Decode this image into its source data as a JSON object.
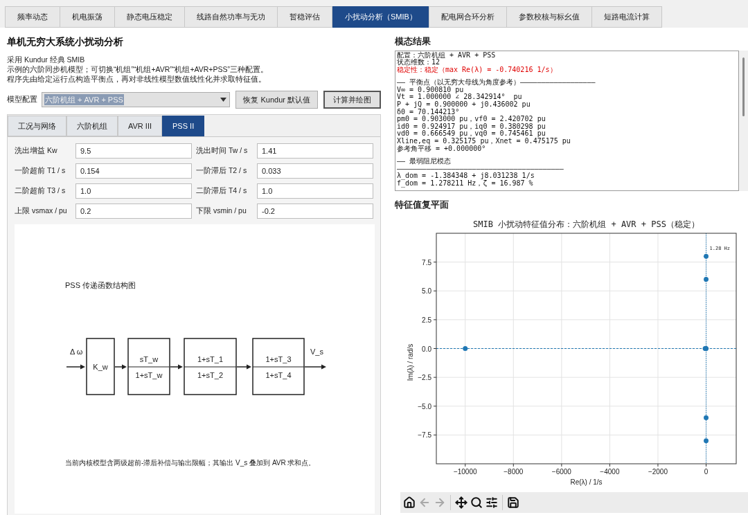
{
  "main_tabs": [
    {
      "label": "频率动态",
      "selected": false
    },
    {
      "label": "机电振荡",
      "selected": false
    },
    {
      "label": "静态电压稳定",
      "selected": false
    },
    {
      "label": "线路自然功率与无功",
      "selected": false
    },
    {
      "label": "暂稳评估",
      "selected": false
    },
    {
      "label": "小扰动分析（SMIB）",
      "selected": true
    },
    {
      "label": "配电网合环分析",
      "selected": false
    },
    {
      "label": "参数校核与标幺值",
      "selected": false
    },
    {
      "label": "短路电流计算",
      "selected": false
    }
  ],
  "left": {
    "title": "单机无穷大系统小扰动分析",
    "description": [
      "采用 Kundur 经典 SMIB",
      "示例的六阶同步机模型；可切换“机组”“机组+AVR”“机组+AVR+PSS”三种配置。",
      "程序先由给定运行点构造平衡点，再对非线性模型数值线性化并求取特征值。"
    ],
    "model_label": "模型配置",
    "model_value": "六阶机组 + AVR + PSS",
    "buttons": [
      {
        "label": "恢复 Kundur 默认值",
        "focused": false
      },
      {
        "label": "计算并绘图",
        "focused": true
      }
    ],
    "sub_tabs": [
      {
        "label": "工况与网络",
        "selected": false
      },
      {
        "label": "六阶机组",
        "selected": false
      },
      {
        "label": "AVR III",
        "selected": false
      },
      {
        "label": "PSS II",
        "selected": true
      }
    ],
    "fields": [
      {
        "label": "洗出增益 Kw",
        "value": "9.5"
      },
      {
        "label": "洗出时间 Tw / s",
        "value": "1.41"
      },
      {
        "label": "一阶超前 T1 / s",
        "value": "0.154"
      },
      {
        "label": "一阶滞后 T2 / s",
        "value": "0.033"
      },
      {
        "label": "二阶超前 T3 / s",
        "value": "1.0"
      },
      {
        "label": "二阶滞后 T4 / s",
        "value": "1.0"
      },
      {
        "label": "上限 vsmax / pu",
        "value": "0.2"
      },
      {
        "label": "下限 vsmin / pu",
        "value": "-0.2"
      }
    ],
    "diagram": {
      "title": "PSS 传递函数结构图",
      "input_label": "Δ ω",
      "output_label": "V_s",
      "blocks": [
        {
          "kind": "gain",
          "label": "K_w"
        },
        {
          "kind": "fraction",
          "numerator": "sT_w",
          "denominator": "1+sT_w"
        },
        {
          "kind": "fraction",
          "numerator": "1+sT_1",
          "denominator": "1+sT_2"
        },
        {
          "kind": "fraction",
          "numerator": "1+sT_3",
          "denominator": "1+sT_4"
        }
      ],
      "caption": "当前内核模型含两级超前-滞后补偿与输出限幅；其输出 V_s 叠加到 AVR 求和点。"
    }
  },
  "right": {
    "results_title": "模态结果",
    "results_lines": [
      {
        "kind": "normal",
        "text": "配置：六阶机组 + AVR + PSS"
      },
      {
        "kind": "normal",
        "text": "状态维数：12"
      },
      {
        "kind": "alert",
        "text": "稳定性：稳定（max Re(λ) = -0.740216 1/s）"
      },
      {
        "kind": "section",
        "text": "—— 平衡点（以无穷大母线为角度参考）——————————————————"
      },
      {
        "kind": "normal",
        "text": "V∞ = 0.900810 pu"
      },
      {
        "kind": "normal",
        "text": "Vt = 1.000000 ∠ 28.342914°  pu"
      },
      {
        "kind": "normal",
        "text": "P + jQ = 0.900000 + j0.436002 pu"
      },
      {
        "kind": "normal",
        "text": "δ0 = 70.144213°"
      },
      {
        "kind": "normal",
        "text": "pm0 = 0.903000 pu，vf0 = 2.420702 pu"
      },
      {
        "kind": "normal",
        "text": "id0 = 0.924917 pu，iq0 = 0.380298 pu"
      },
      {
        "kind": "normal",
        "text": "vd0 = 0.666549 pu，vq0 = 0.745461 pu"
      },
      {
        "kind": "normal",
        "text": "Xline,eq = 0.325175 pu，Xnet = 0.475175 pu"
      },
      {
        "kind": "normal",
        "text": "参考角平移 = +0.000000°"
      },
      {
        "kind": "section",
        "text": "—— 最弱阻尼模态"
      },
      {
        "kind": "normal",
        "text": "————————————————————————————————————————"
      },
      {
        "kind": "normal",
        "text": "λ_dom = -1.384348 + j8.031238 1/s"
      },
      {
        "kind": "normal",
        "text": "f_dom = 1.278211 Hz，ζ = 16.987 %"
      }
    ],
    "plot_title": "特征值复平面",
    "chart_data": {
      "type": "scatter",
      "title": "SMIB 小扰动特征值分布：六阶机组 + AVR + PSS（稳定）",
      "xlabel": "Re(λ) / 1/s",
      "ylabel": "Im(λ) / rad/s",
      "x": [
        -10000,
        -40,
        -15,
        0,
        -1.384348,
        -1.384348,
        -0.8,
        -0.8
      ],
      "series": [
        {
          "color": "#1f77b4",
          "values": [
            0,
            0,
            0,
            0,
            8.0,
            -8.0,
            6,
            -6
          ]
        }
      ],
      "grid": true,
      "xlim": [
        -11200,
        1250
      ],
      "ylim": [
        -10,
        10
      ],
      "xticks": [
        {
          "value": -10000,
          "label": "−10000"
        },
        {
          "value": -8000,
          "label": "−8000"
        },
        {
          "value": -6000,
          "label": "−6000"
        },
        {
          "value": -4000,
          "label": "−4000"
        },
        {
          "value": -2000,
          "label": "−2000"
        },
        {
          "value": 0,
          "label": "0"
        }
      ],
      "yticks": [
        {
          "value": -7.5,
          "label": "−7.5"
        },
        {
          "value": -5,
          "label": "−5.0"
        },
        {
          "value": -2.5,
          "label": "−2.5"
        },
        {
          "value": 0,
          "label": "0.0"
        },
        {
          "value": 2.5,
          "label": "2.5"
        },
        {
          "value": 5,
          "label": "5.0"
        },
        {
          "value": 7.5,
          "label": "7.5"
        }
      ],
      "annotations": [
        {
          "x": 0,
          "y": 8.0,
          "text": "1.28 Hz"
        }
      ]
    },
    "toolbar": [
      {
        "kind": "home",
        "disabled": false
      },
      {
        "kind": "back",
        "disabled": true
      },
      {
        "kind": "forward",
        "disabled": true
      },
      {
        "kind": "pan",
        "disabled": false
      },
      {
        "kind": "zoom",
        "disabled": false
      },
      {
        "kind": "configure",
        "disabled": false
      },
      {
        "kind": "save",
        "disabled": false
      }
    ]
  }
}
